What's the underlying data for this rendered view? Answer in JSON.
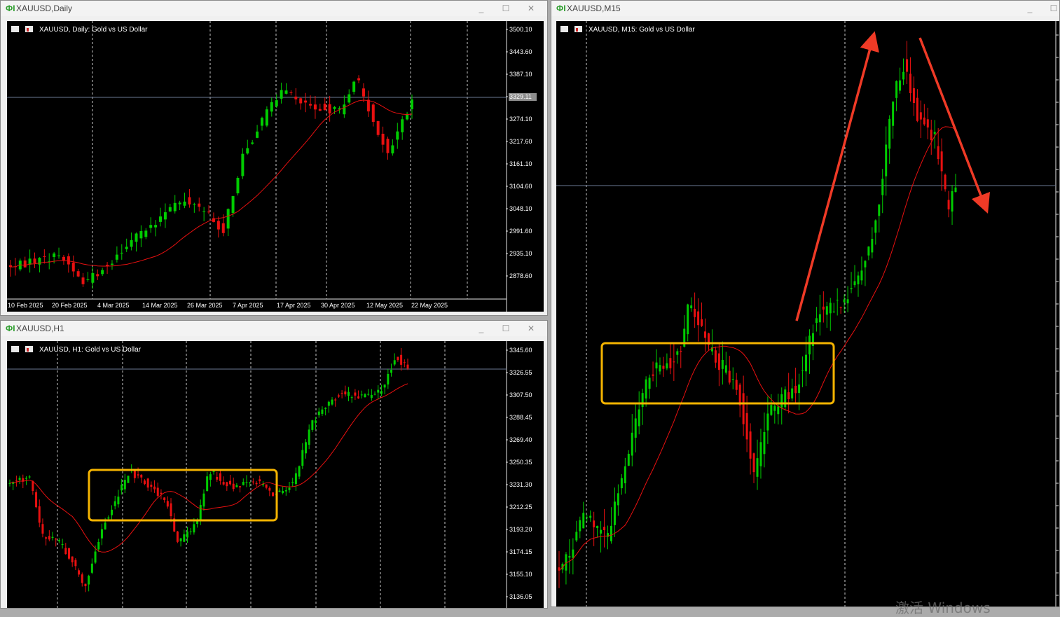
{
  "colors": {
    "bull": "#00cc00",
    "bear": "#e81010",
    "ma": "#e81010",
    "grid": "#c8c8c8",
    "text": "#ffffff",
    "price_line": "#6b7a95",
    "box": "#f5b400",
    "arrow": "#ef3a26"
  },
  "windows": {
    "daily": {
      "title": "XAUUSD,Daily",
      "header": "XAUUSD, Daily:  Gold vs US Dollar",
      "current_price": "3329.11",
      "price_labels": [
        "3500.10",
        "3443.60",
        "3387.10",
        "3329.11",
        "3274.10",
        "3217.60",
        "3161.10",
        "3104.60",
        "3048.10",
        "2991.60",
        "2935.10",
        "2878.60"
      ],
      "date_labels": [
        "10 Feb 2025",
        "20 Feb 2025",
        "4 Mar 2025",
        "14 Mar 2025",
        "26 Mar 2025",
        "7 Apr 2025",
        "17 Apr 2025",
        "30 Apr 2025",
        "12 May 2025",
        "22 May 2025"
      ]
    },
    "h1": {
      "title": "XAUUSD,H1",
      "header": "XAUUSD, H1:  Gold vs US Dollar",
      "current_price": "3329.11",
      "price_labels": [
        "3345.60",
        "3326.55",
        "3307.50",
        "3288.45",
        "3269.40",
        "3250.35",
        "3231.30",
        "3212.25",
        "3193.20",
        "3174.15",
        "3155.10",
        "3136.05"
      ]
    },
    "m15": {
      "title": "XAUUSD,M15",
      "header": "XAUUSD, M15:  Gold vs US Dollar"
    }
  },
  "watermark": "激活 Windows"
}
